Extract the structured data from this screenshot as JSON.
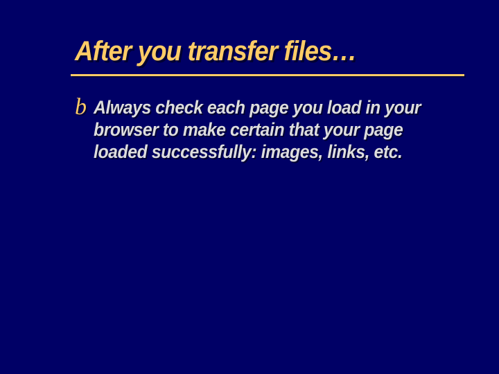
{
  "slide": {
    "title": "After you transfer files…",
    "bullets": [
      {
        "marker": "b",
        "text": "Always check each page you load in your browser to make certain that your page loaded successfully:  images, links, etc."
      }
    ]
  }
}
